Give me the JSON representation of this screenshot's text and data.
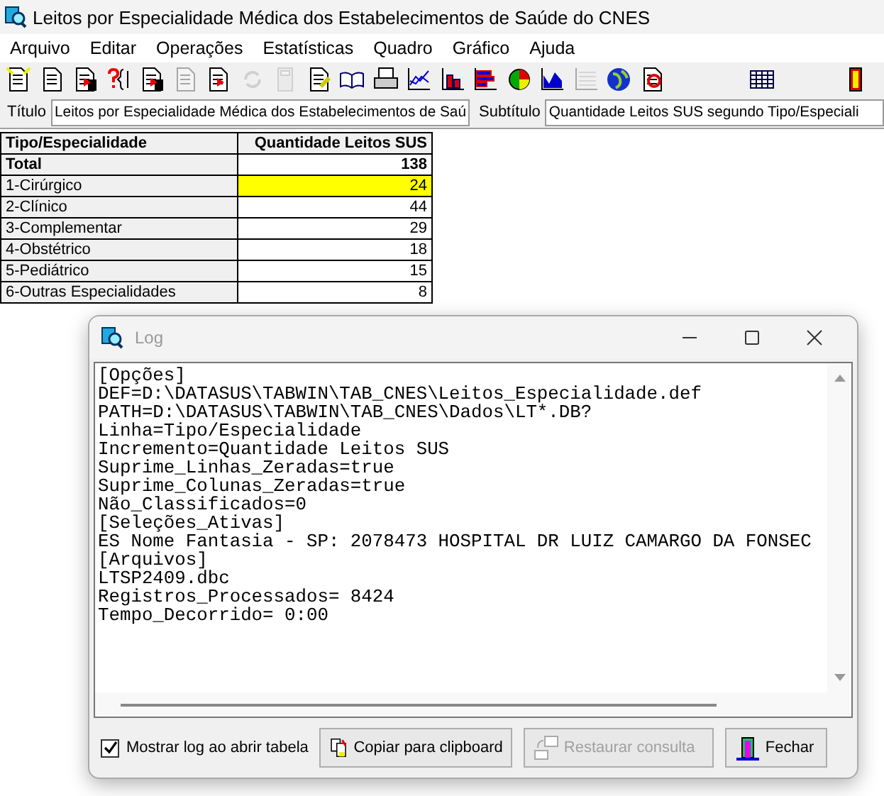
{
  "window": {
    "title": "Leitos por Especialidade Médica dos Estabelecimentos de Saúde do CNES"
  },
  "menu": [
    "Arquivo",
    "Editar",
    "Operações",
    "Estatísticas",
    "Quadro",
    "Gráfico",
    "Ajuda"
  ],
  "toolbar": [
    {
      "kind": "newdoc",
      "disabled": false
    },
    {
      "kind": "doc",
      "disabled": false
    },
    {
      "kind": "savedoc",
      "disabled": false
    },
    {
      "kind": "query",
      "disabled": false
    },
    {
      "kind": "savedoc",
      "disabled": false
    },
    {
      "kind": "doc",
      "disabled": true
    },
    {
      "kind": "arrowdoc",
      "disabled": false
    },
    {
      "kind": "refresh",
      "disabled": true
    },
    {
      "kind": "calculator",
      "disabled": true
    },
    {
      "kind": "editdoc",
      "disabled": false
    },
    {
      "kind": "book",
      "disabled": false
    },
    {
      "kind": "printer",
      "disabled": false
    },
    {
      "kind": "linechart",
      "disabled": false
    },
    {
      "kind": "barchart",
      "disabled": false
    },
    {
      "kind": "hbarchart",
      "disabled": false
    },
    {
      "kind": "piechart",
      "disabled": false
    },
    {
      "kind": "areachart",
      "disabled": false
    },
    {
      "kind": "grid",
      "disabled": true
    },
    {
      "kind": "globe",
      "disabled": false
    },
    {
      "kind": "mapdoc",
      "disabled": false
    },
    {
      "kind": "table",
      "disabled": false
    },
    {
      "kind": "door",
      "disabled": false
    }
  ],
  "title_label": "Título",
  "title_value": "Leitos por Especialidade Médica dos Estabelecimentos de Saú",
  "subtitle_label": "Subtítulo",
  "subtitle_value": "Quantidade Leitos SUS segundo Tipo/Especiali",
  "table": {
    "columns": [
      "Tipo/Especialidade",
      "Quantidade Leitos SUS"
    ],
    "rows": [
      {
        "kind": "total",
        "label": "Total",
        "value": "138",
        "selected": false
      },
      {
        "kind": "item",
        "label": "1-Cirúrgico",
        "value": "24",
        "selected": true
      },
      {
        "kind": "item",
        "label": "2-Clínico",
        "value": "44",
        "selected": false
      },
      {
        "kind": "item",
        "label": "3-Complementar",
        "value": "29",
        "selected": false
      },
      {
        "kind": "item",
        "label": "4-Obstétrico",
        "value": "18",
        "selected": false
      },
      {
        "kind": "item",
        "label": "5-Pediátrico",
        "value": "15",
        "selected": false
      },
      {
        "kind": "item",
        "label": "6-Outras Especialidades",
        "value": "8",
        "selected": false
      }
    ]
  },
  "log": {
    "title": "Log",
    "lines": [
      "[Opções]",
      "DEF=D:\\DATASUS\\TABWIN\\TAB_CNES\\Leitos_Especialidade.def",
      "PATH=D:\\DATASUS\\TABWIN\\TAB_CNES\\Dados\\LT*.DB?",
      "Linha=Tipo/Especialidade",
      "Incremento=Quantidade Leitos SUS",
      "Suprime_Linhas_Zeradas=true",
      "Suprime_Colunas_Zeradas=true",
      "Não_Classificados=0",
      "[Seleções_Ativas]",
      "ES Nome Fantasia - SP: 2078473 HOSPITAL DR LUIZ CAMARGO DA FONSEC",
      "[Arquivos]",
      "LTSP2409.dbc",
      "Registros_Processados= 8424",
      "Tempo_Decorrido= 0:00"
    ],
    "show_log": {
      "label": "Mostrar log ao abrir tabela",
      "checked": true
    },
    "buttons": [
      {
        "kind": "copy",
        "label": "Copiar para clipboard",
        "disabled": false
      },
      {
        "kind": "restore",
        "label": "Restaurar consulta",
        "disabled": true
      },
      {
        "kind": "close",
        "label": "Fechar",
        "disabled": false
      }
    ]
  }
}
